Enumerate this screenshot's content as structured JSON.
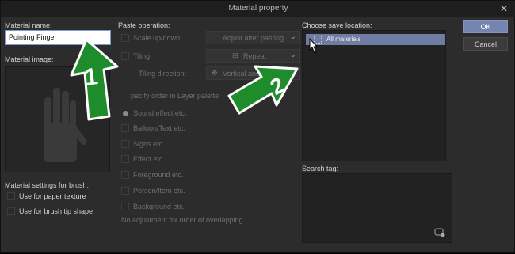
{
  "window": {
    "title": "Material property",
    "close_label": "✕"
  },
  "left": {
    "name_label": "Material name:",
    "name_value": "Pointing Finger",
    "image_label": "Material image:",
    "brush_label": "Material settings for brush:",
    "brush_options": [
      "Use for paper texture",
      "Use for brush tip shape"
    ]
  },
  "paste": {
    "label": "Paste operation:",
    "scale_label": "Scale up/down",
    "scale_value": "Adjust after pasting",
    "tiling_label": "Tiling",
    "tiling_value": "Repeat",
    "tiling_dir_label": "Tiling direction:",
    "tiling_dir_value": "Vertical and h",
    "order_label": "pecify order in Layer palette",
    "orders": [
      "Sound effect etc.",
      "Balloon/Text etc.",
      "Signs etc.",
      "Effect etc.",
      "Foreground etc.",
      "Person/Item etc.",
      "Background etc."
    ],
    "no_adjust": "No adjustment for order of overlapping."
  },
  "right": {
    "location_label": "Choose save location:",
    "location_item": "All materials",
    "tag_label": "Search tag:"
  },
  "buttons": {
    "ok": "OK",
    "cancel": "Cancel"
  },
  "annotations": {
    "one": "1",
    "two": "2"
  },
  "colors": {
    "accent": "#7585b2",
    "arrow_fill": "#1e8c2b",
    "arrow_stroke": "#ffffff"
  }
}
